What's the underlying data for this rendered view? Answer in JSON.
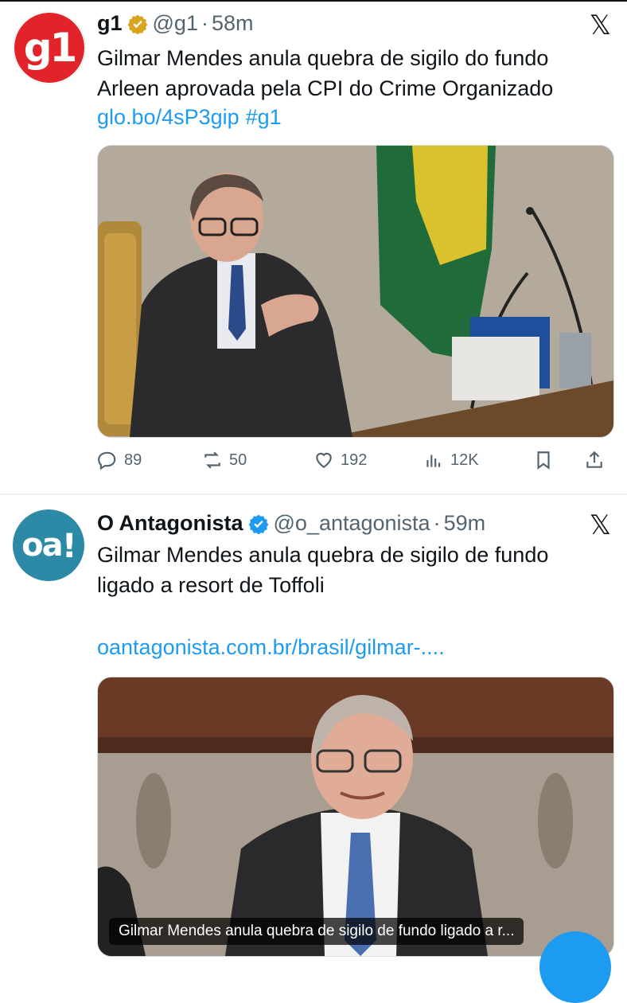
{
  "tweets": [
    {
      "author": "g1",
      "handle": "@g1",
      "separator": "·",
      "time": "58m",
      "avatar_text": "g1",
      "text": "Gilmar Mendes anula quebra de sigilo do fundo Arleen aprovada pela CPI do Crime Organizado",
      "link": "glo.bo/4sP3gip",
      "hashtag": "#g1",
      "badge": "gold-verified-badge",
      "stats": {
        "replies": "89",
        "reposts": "50",
        "likes": "192",
        "views": "12K"
      }
    },
    {
      "author": "O Antagonista",
      "handle": "@o_antagonista",
      "separator": "·",
      "time": "59m",
      "avatar_text": "oa",
      "avatar_mark": "!",
      "text": "Gilmar Mendes anula quebra de sigilo de fundo ligado a resort de Toffoli",
      "link": "oantagonista.com.br/brasil/gilmar-....",
      "badge": "blue-verified-badge",
      "card_caption": "Gilmar Mendes anula quebra de sigilo de fundo ligado a r..."
    }
  ],
  "platform_logo": "𝕏",
  "colors": {
    "link": "#1d9bf0",
    "muted": "#536471",
    "g1_red": "#e2232a",
    "oa_teal": "#2c8aa6"
  }
}
